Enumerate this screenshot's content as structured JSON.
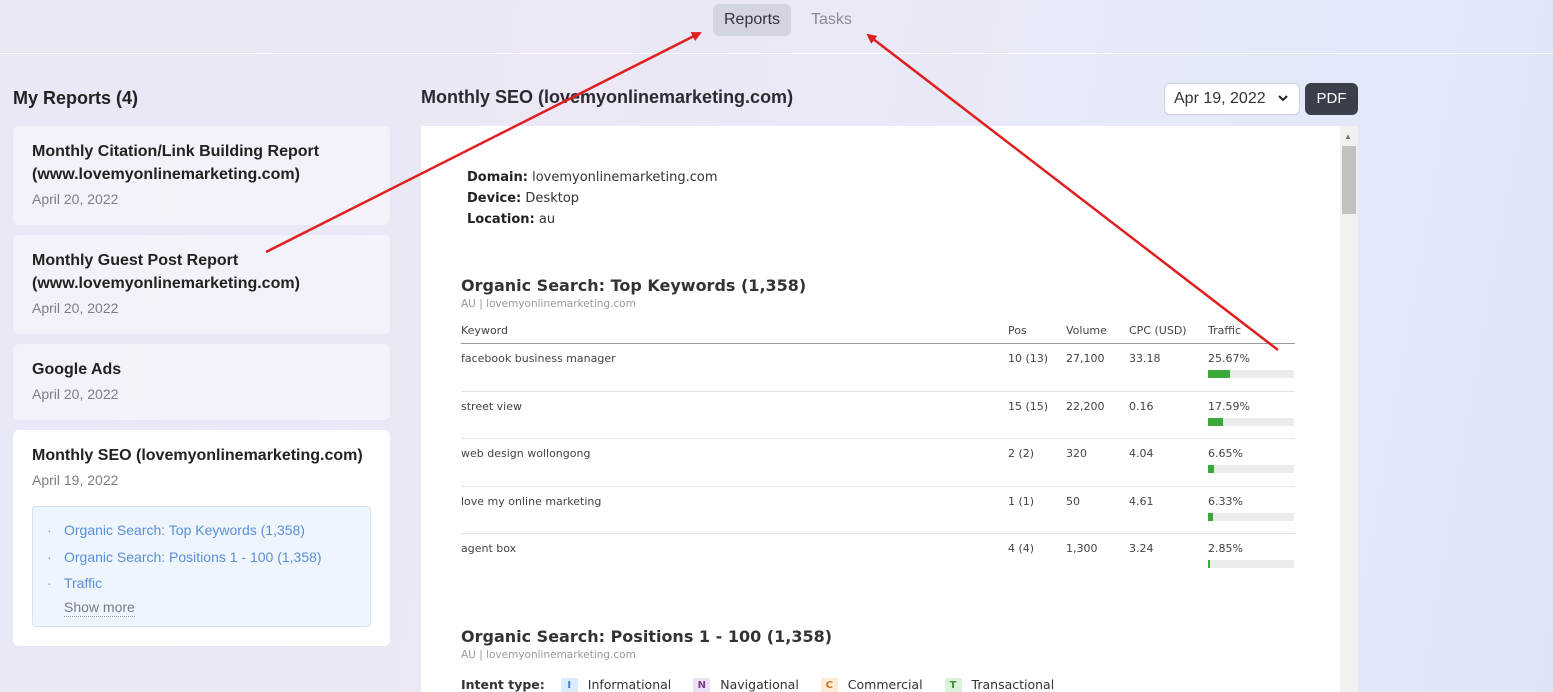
{
  "nav": {
    "tabs": [
      {
        "label": "Reports",
        "active": true
      },
      {
        "label": "Tasks",
        "active": false
      }
    ]
  },
  "sidebar": {
    "title": "My Reports (4)",
    "reports": [
      {
        "title": "Monthly Citation/Link Building Report (www.lovemyonlinemarketing.com)",
        "date": "April 20, 2022"
      },
      {
        "title": "Monthly Guest Post Report (www.lovemyonlinemarketing.com)",
        "date": "April 20, 2022"
      },
      {
        "title": "Google Ads",
        "date": "April 20, 2022"
      },
      {
        "title": "Monthly SEO (lovemyonlinemarketing.com)",
        "date": "April 19, 2022",
        "selected": true
      }
    ],
    "toc": {
      "items": [
        "Organic Search: Top Keywords (1,358)",
        "Organic Search: Positions 1 - 100 (1,358)",
        "Traffic"
      ],
      "show_more": "Show more"
    }
  },
  "main": {
    "title": "Monthly SEO (lovemyonlinemarketing.com)",
    "date_select": "Apr 19, 2022",
    "pdf_label": "PDF"
  },
  "report": {
    "meta": {
      "domain_label": "Domain:",
      "domain": "lovemyonlinemarketing.com",
      "device_label": "Device:",
      "device": "Desktop",
      "location_label": "Location:",
      "location": "au"
    },
    "top_keywords": {
      "title": "Organic Search: Top Keywords (1,358)",
      "subtitle": "AU | lovemyonlinemarketing.com",
      "columns": [
        "Keyword",
        "Pos",
        "Volume",
        "CPC (USD)",
        "Traffic"
      ],
      "rows": [
        {
          "keyword": "facebook business manager",
          "pos": "10 (13)",
          "volume": "27,100",
          "cpc": "33.18",
          "traffic": "25.67%",
          "traffic_pct": 25.67
        },
        {
          "keyword": "street view",
          "pos": "15 (15)",
          "volume": "22,200",
          "cpc": "0.16",
          "traffic": "17.59%",
          "traffic_pct": 17.59
        },
        {
          "keyword": "web design wollongong",
          "pos": "2 (2)",
          "volume": "320",
          "cpc": "4.04",
          "traffic": "6.65%",
          "traffic_pct": 6.65
        },
        {
          "keyword": "love my online marketing",
          "pos": "1 (1)",
          "volume": "50",
          "cpc": "4.61",
          "traffic": "6.33%",
          "traffic_pct": 6.33
        },
        {
          "keyword": "agent box",
          "pos": "4 (4)",
          "volume": "1,300",
          "cpc": "3.24",
          "traffic": "2.85%",
          "traffic_pct": 2.85
        }
      ]
    },
    "positions": {
      "title": "Organic Search: Positions 1 - 100 (1,358)",
      "subtitle": "AU | lovemyonlinemarketing.com",
      "intent_label": "Intent type:",
      "intents": [
        {
          "badge": "I",
          "label": "Informational"
        },
        {
          "badge": "N",
          "label": "Navigational"
        },
        {
          "badge": "C",
          "label": "Commercial"
        },
        {
          "badge": "T",
          "label": "Transactional"
        }
      ]
    }
  },
  "colors": {
    "accent_link": "#5a8fd6",
    "traffic_bar": "#3aa83a",
    "annotation_arrow": "#e02020",
    "pdf_button": "#3b3f4a"
  }
}
